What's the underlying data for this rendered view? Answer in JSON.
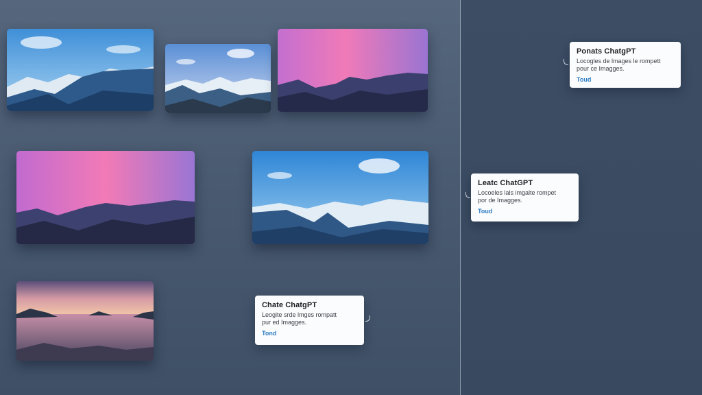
{
  "thumbnails": [
    {
      "name": "thumb-blue-sky-mountains",
      "scene": "blue-sky mountains"
    },
    {
      "name": "thumb-lake-sky-mountains",
      "scene": "blue-sky mountains"
    },
    {
      "name": "thumb-pink-sky-mountains",
      "scene": "pink-sky mountains"
    },
    {
      "name": "thumb-pink-sky-ridge",
      "scene": "pink-sky mountains"
    },
    {
      "name": "thumb-blue-sky-glacier",
      "scene": "blue-sky mountains"
    },
    {
      "name": "thumb-sunset-lake",
      "scene": "sunset lake"
    }
  ],
  "cards": {
    "top": {
      "title": "Ponats ChatgPT",
      "description": "Locogles de lmages le rompett\npour ce Imagges.",
      "link": "Toud"
    },
    "middle": {
      "title": "Leatc ChatGPT",
      "description": "Locoeles lals imgalte rompet\npor de Imagges.",
      "link": "Toud"
    },
    "bottom": {
      "title": "Chate ChatgPT",
      "description": "Leogite srde lmges rompatt\npur ed Imagges.",
      "link": "Tond"
    }
  }
}
